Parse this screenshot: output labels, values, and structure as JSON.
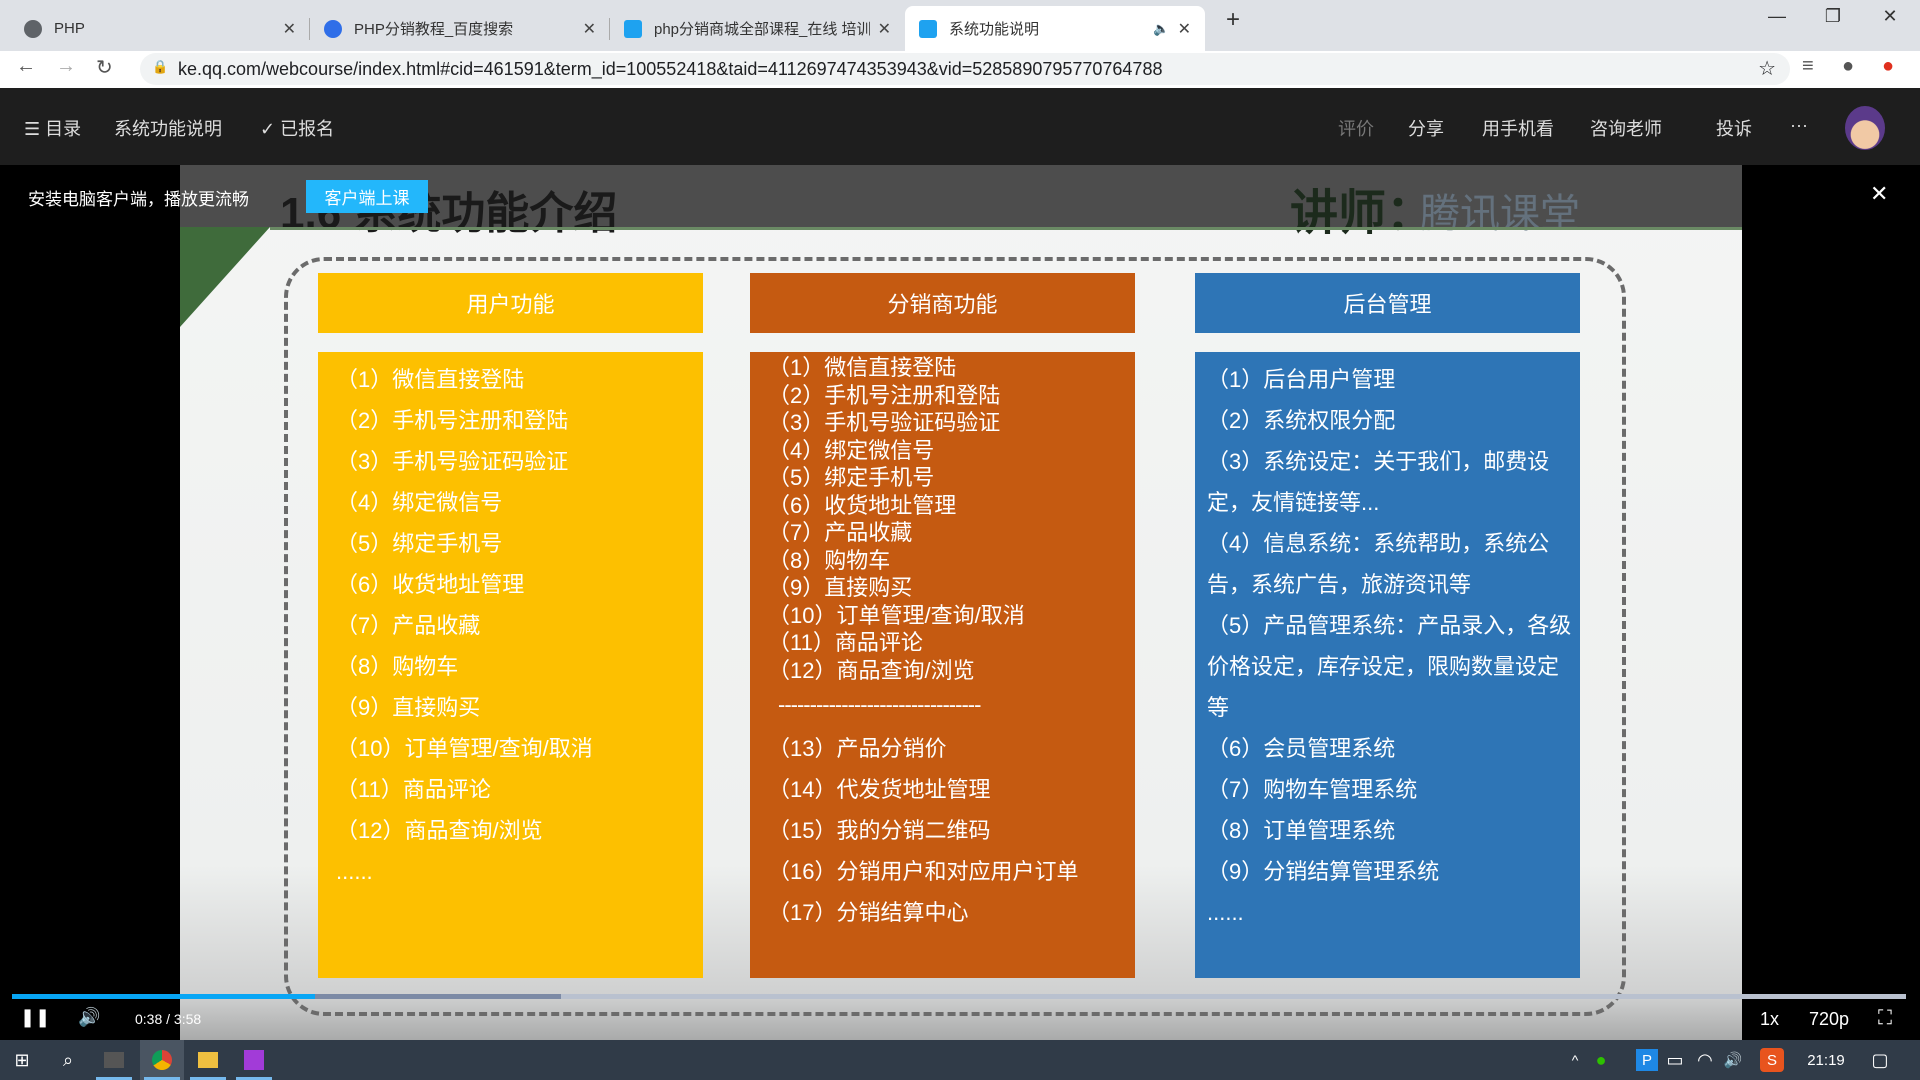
{
  "browser": {
    "tabs": [
      {
        "title": "PHP",
        "close": "✕"
      },
      {
        "title": "PHP分销教程_百度搜索",
        "close": "✕"
      },
      {
        "title": "php分销商城全部课程_在线 培训",
        "close": "✕"
      },
      {
        "title": "系统功能说明",
        "close": "✕",
        "audio": "🔈"
      }
    ],
    "new_tab": "+",
    "window": {
      "minimize": "—",
      "restore": "❐",
      "close": "✕"
    },
    "nav": {
      "back": "←",
      "forward": "→",
      "reload": "↻"
    },
    "url": "ke.qq.com/webcourse/index.html#cid=461591&term_id=100552418&taid=4112697474353943&vid=5285890795770764788",
    "icons": {
      "lock": "🔒",
      "star": "☆",
      "media": "≡",
      "profile": "●",
      "ext": "●"
    }
  },
  "header": {
    "menu_label": "☰ 目录",
    "title": "系统功能说明",
    "enrolled": "✓ 已报名",
    "right": [
      "评价",
      "分享",
      "用手机看",
      "咨询老师",
      "投诉",
      "···"
    ]
  },
  "video": {
    "banner_text": "安装电脑客户端，播放更流畅",
    "client_button": "客户端上课",
    "close": "✕",
    "slide": {
      "title": "1.6 系统功能介绍",
      "teacher": "讲师：",
      "watermark": "腾讯课堂",
      "columns": [
        {
          "header": "用户功能",
          "items": [
            "（1）微信直接登陆",
            "（2）手机号注册和登陆",
            "（3）手机号验证码验证",
            "（4）绑定微信号",
            "（5）绑定手机号",
            "（6）收货地址管理",
            "（7）产品收藏",
            "（8）购物车",
            "（9）直接购买",
            "（10）订单管理/查询/取消",
            "（11）商品评论",
            "（12）商品查询/浏览",
            "......"
          ]
        },
        {
          "header": "分销商功能",
          "items": [
            "（1）微信直接登陆",
            "（2）手机号注册和登陆",
            "（3）手机号验证码验证",
            "（4）绑定微信号",
            "（5）绑定手机号",
            "（6）收货地址管理",
            "（7）产品收藏",
            "（8）购物车",
            "（9）直接购买",
            "（10）订单管理/查询/取消",
            "（11）商品评论",
            "（12）商品查询/浏览"
          ],
          "divider": "--------------------------------",
          "items2": [
            "（13）产品分销价",
            "（14）代发货地址管理",
            "（15）我的分销二维码",
            "（16）分销用户和对应用户订单",
            "（17）分销结算中心"
          ]
        },
        {
          "header": "后台管理",
          "items": [
            "（1）后台用户管理",
            "（2）系统权限分配",
            "（3）系统设定：关于我们，邮费设定，友情链接等...",
            "（4）信息系统：系统帮助，系统公告，系统广告，旅游资讯等",
            "（5）产品管理系统：产品录入，各级价格设定，库存设定，限购数量设定等",
            "（6）会员管理系统",
            "（7）购物车管理系统",
            "（8）订单管理系统",
            "（9）分销结算管理系统",
            "......"
          ]
        }
      ]
    },
    "player": {
      "time": "0:38 / 3:58",
      "progress_played": 0.16,
      "progress_buffered": 0.29,
      "speed": "1x",
      "quality": "720p",
      "pause": "❚❚",
      "volume": "🔊",
      "fullscreen": "⛶"
    }
  },
  "taskbar": {
    "clock": "21:19",
    "start": "⊞",
    "search": "⌕",
    "tray": [
      "^",
      "●",
      "P",
      "▭",
      "◠",
      "🔊",
      "S"
    ],
    "notify": "▢"
  },
  "colors": {
    "yellow": "#fdc000",
    "orange": "#c55a11",
    "blue": "#2e75b6",
    "accent": "#23b7fb"
  }
}
